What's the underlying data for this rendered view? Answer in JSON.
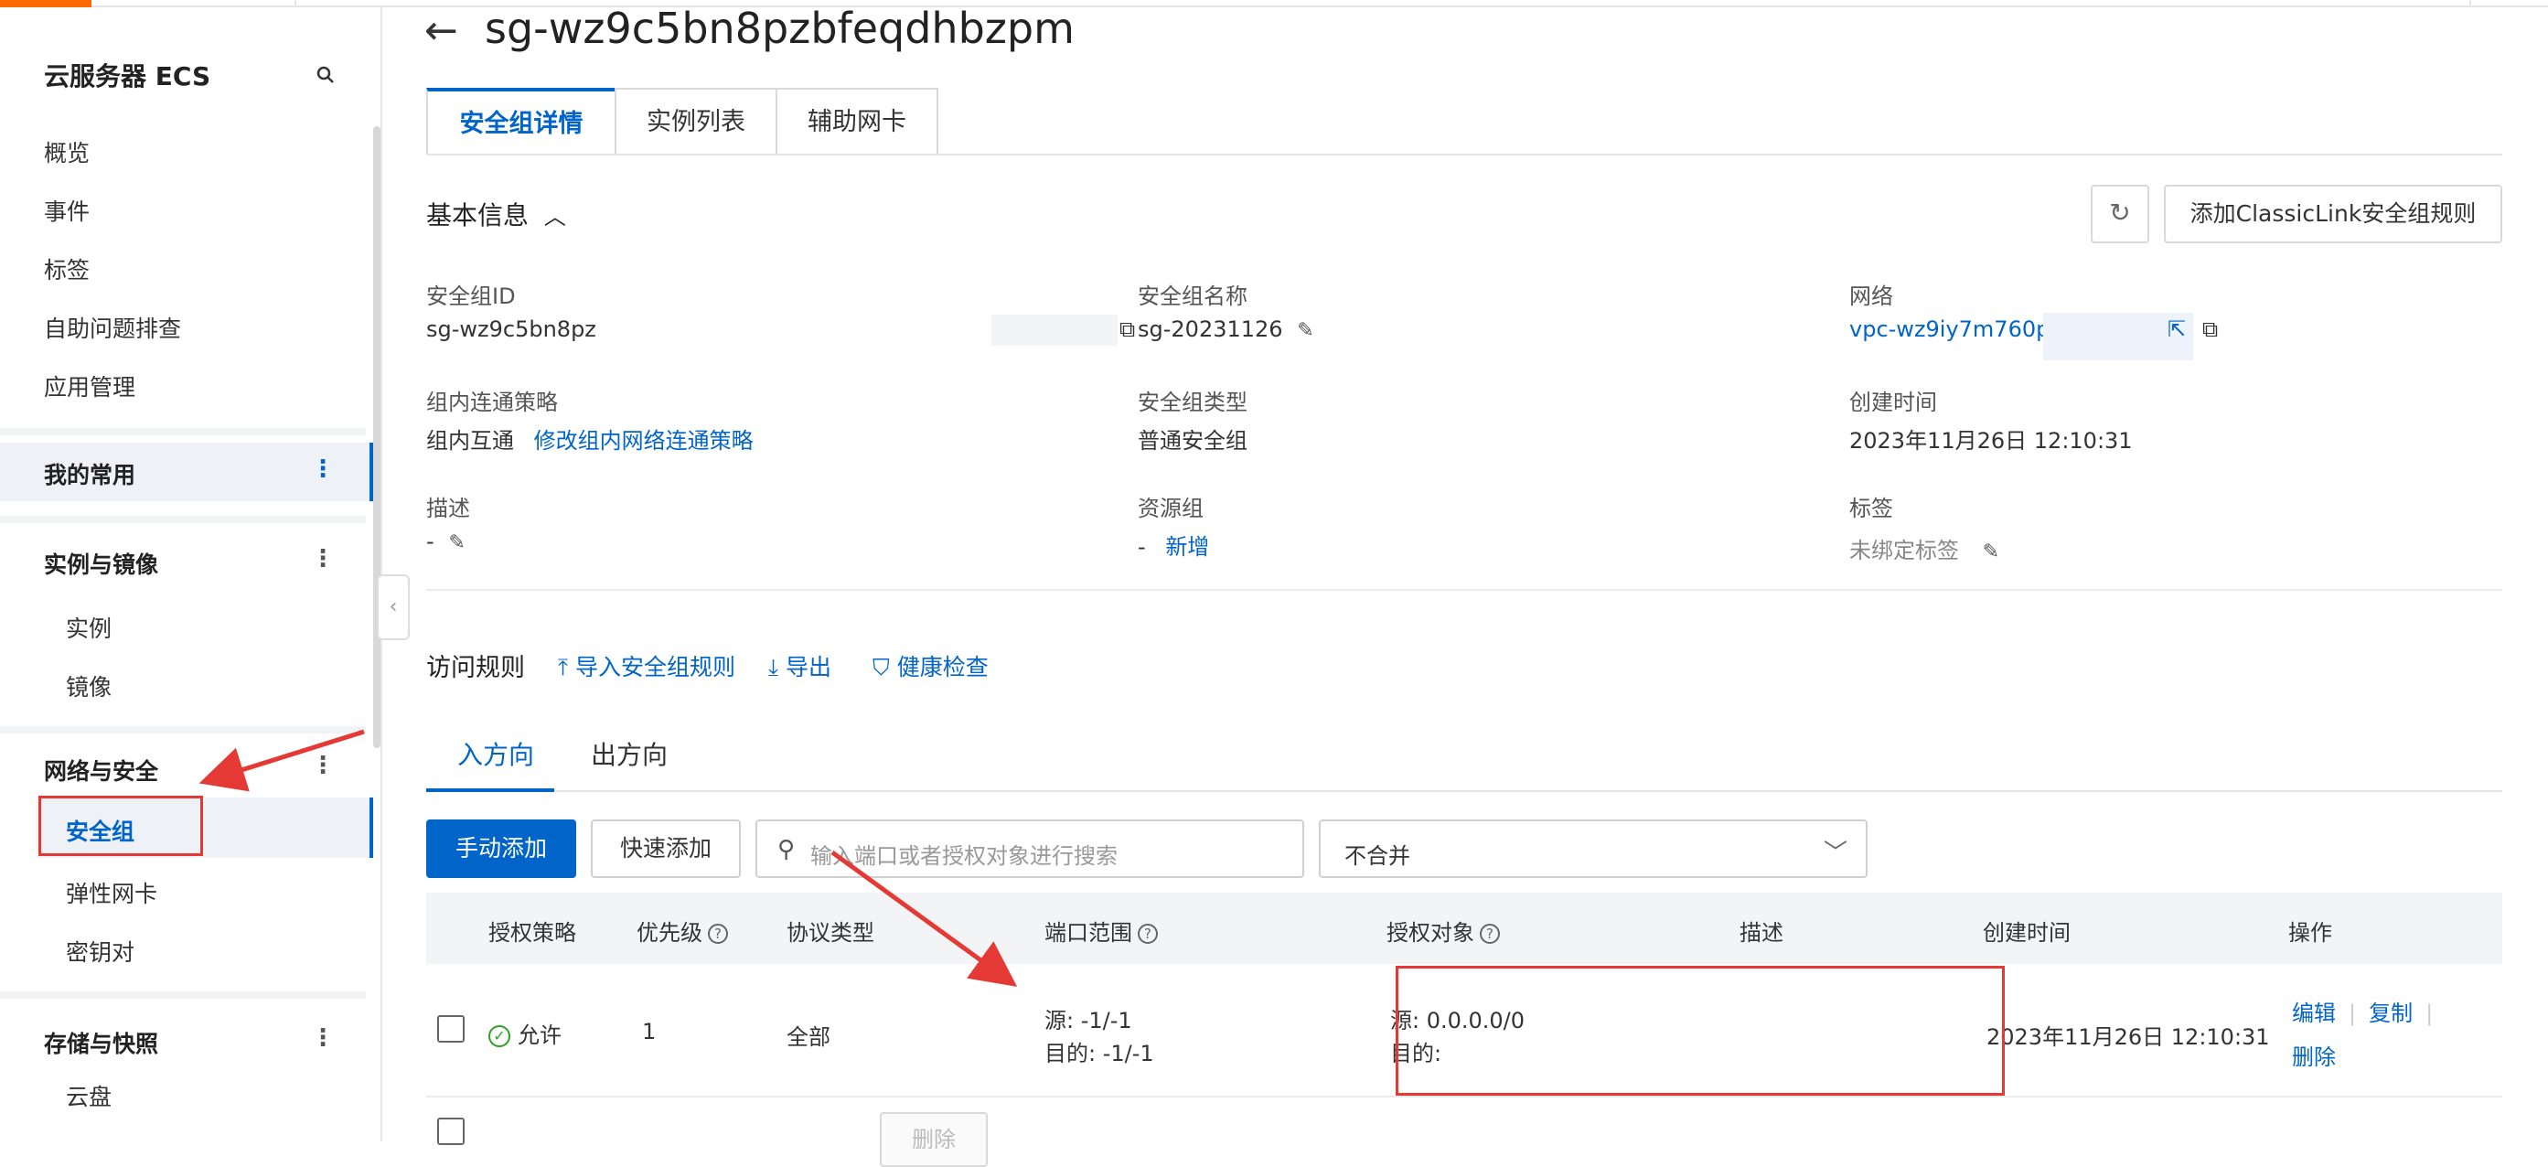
{
  "sidebar": {
    "title": "云服务器 ECS",
    "top_items": [
      "概览",
      "事件",
      "标签",
      "自助问题排查",
      "应用管理"
    ],
    "favorites": "我的常用",
    "groups": {
      "instances": {
        "label": "实例与镜像",
        "items": [
          "实例",
          "镜像"
        ]
      },
      "network": {
        "label": "网络与安全",
        "items": [
          "安全组",
          "弹性网卡",
          "密钥对"
        ]
      },
      "storage": {
        "label": "存储与快照",
        "items": [
          "云盘"
        ]
      }
    },
    "more_glyph": "⋮"
  },
  "header": {
    "back_glyph": "←",
    "title": "sg-wz9c5bn8pzbfeqdhbzpm"
  },
  "tabs": [
    "安全组详情",
    "实例列表",
    "辅助网卡"
  ],
  "basic": {
    "title": "基本信息",
    "refresh_glyph": "↻",
    "classic_button": "添加ClassicLink安全组规则",
    "fields": {
      "sg_id": {
        "label": "安全组ID",
        "value": "sg-wz9c5bn8pz"
      },
      "sg_name": {
        "label": "安全组名称",
        "value": "sg-20231126"
      },
      "network": {
        "label": "网络",
        "value": "vpc-wz9iy7m760p"
      },
      "policy": {
        "label": "组内连通策略",
        "value": "组内互通",
        "link": "修改组内网络连通策略"
      },
      "sg_type": {
        "label": "安全组类型",
        "value": "普通安全组"
      },
      "created": {
        "label": "创建时间",
        "value": "2023年11月26日 12:10:31"
      },
      "desc": {
        "label": "描述",
        "value": "-"
      },
      "resource_group": {
        "label": "资源组",
        "value": "-",
        "link": "新增"
      },
      "tags": {
        "label": "标签",
        "value": "未绑定标签"
      }
    }
  },
  "rules": {
    "title": "访问规则",
    "links": [
      "导入安全组规则",
      "导出",
      "健康检查"
    ],
    "directions": [
      "入方向",
      "出方向"
    ],
    "toolbar": {
      "manual_add": "手动添加",
      "quick_add": "快速添加",
      "search_placeholder": "输入端口或者授权对象进行搜索",
      "merge_select": "不合并"
    },
    "columns": [
      "授权策略",
      "优先级",
      "协议类型",
      "端口范围",
      "授权对象",
      "描述",
      "创建时间",
      "操作"
    ],
    "rows": [
      {
        "policy": "允许",
        "priority": "1",
        "protocol": "全部",
        "port_src": "源: -1/-1",
        "port_dst": "目的: -1/-1",
        "auth_src": "源: 0.0.0.0/0",
        "auth_dst": "目的:",
        "desc": "",
        "created": "2023年11月26日 12:10:31",
        "ops": [
          "编辑",
          "复制",
          "删除"
        ]
      }
    ],
    "delete_button": "删除"
  },
  "colors": {
    "accent": "#0064c8",
    "annotation_red": "#e53935",
    "allow_green": "#2ea121",
    "brand_orange": "#ff6a00"
  }
}
